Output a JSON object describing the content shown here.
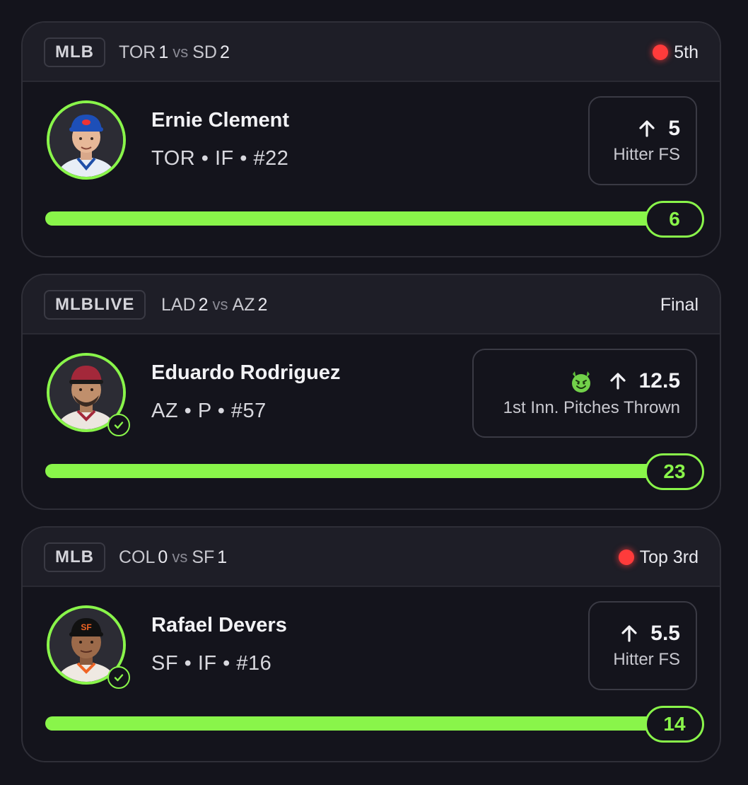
{
  "colors": {
    "accent_green": "#89f54a",
    "live_red": "#ff3b3b",
    "background": "#14141c",
    "header_bg": "#1e1e27"
  },
  "cards": [
    {
      "league": "MLB",
      "away_team": "TOR",
      "away_score": "1",
      "vs": "vs",
      "home_team": "SD",
      "home_score": "2",
      "status": "5th",
      "live": true,
      "player_name": "Ernie Clement",
      "player_meta": "TOR • IF • #22",
      "checked": false,
      "prop_direction_icon": "arrow-up-icon",
      "prop_line": "5",
      "prop_label": "Hitter FS",
      "has_devil_icon": false,
      "progress_value": "6",
      "progress_fraction": 1.0
    },
    {
      "league": "MLBLIVE",
      "away_team": "LAD",
      "away_score": "2",
      "vs": "vs",
      "home_team": "AZ",
      "home_score": "2",
      "status": "Final",
      "live": false,
      "player_name": "Eduardo Rodriguez",
      "player_meta": "AZ • P • #57",
      "checked": true,
      "prop_direction_icon": "arrow-up-icon",
      "prop_line": "12.5",
      "prop_label": "1st Inn. Pitches Thrown",
      "has_devil_icon": true,
      "progress_value": "23",
      "progress_fraction": 1.0
    },
    {
      "league": "MLB",
      "away_team": "COL",
      "away_score": "0",
      "vs": "vs",
      "home_team": "SF",
      "home_score": "1",
      "status": "Top 3rd",
      "live": true,
      "player_name": "Rafael Devers",
      "player_meta": "SF • IF • #16",
      "checked": true,
      "prop_direction_icon": "arrow-up-icon",
      "prop_line": "5.5",
      "prop_label": "Hitter FS",
      "has_devil_icon": false,
      "progress_value": "14",
      "progress_fraction": 1.0
    }
  ]
}
